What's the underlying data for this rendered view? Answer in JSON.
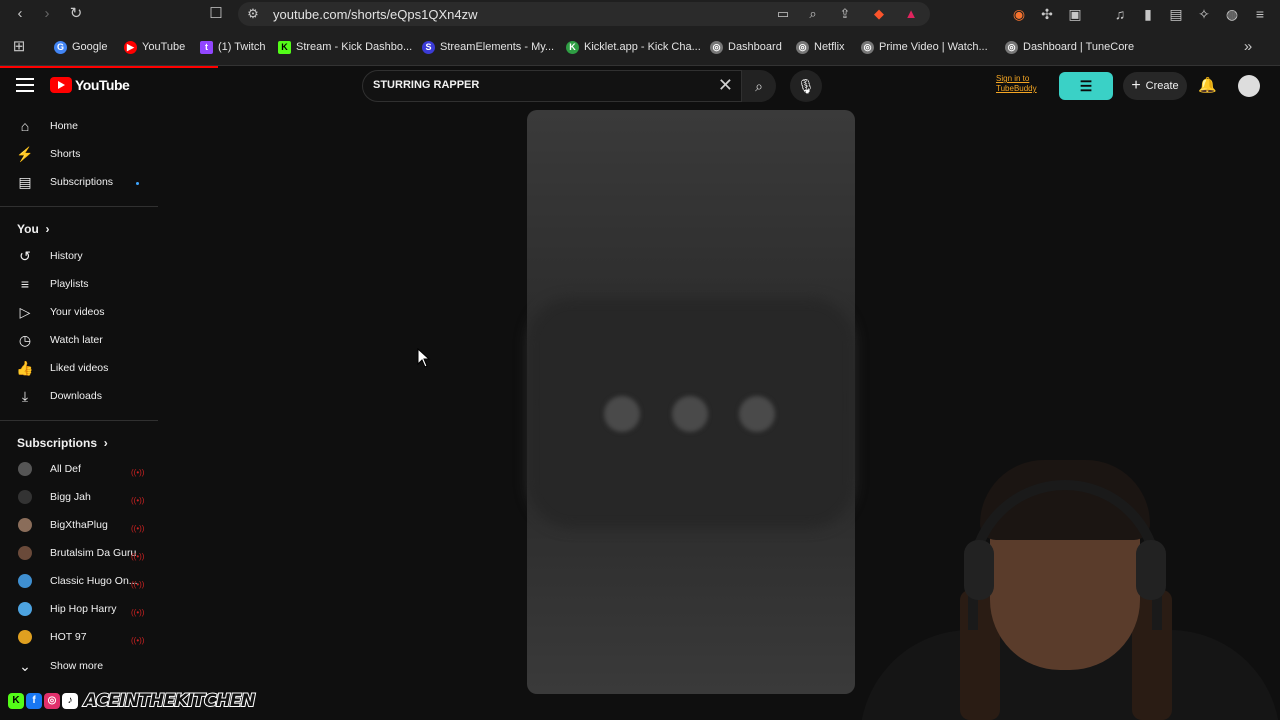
{
  "browser": {
    "url": "youtube.com/shorts/eQps1QXn4zw",
    "bookmarks": [
      {
        "label": "Google",
        "color": "#4285f4",
        "glyph": "G"
      },
      {
        "label": "YouTube",
        "color": "#ff0000",
        "glyph": "▶"
      },
      {
        "label": "(1) Twitch",
        "color": "#9146ff",
        "glyph": "t"
      },
      {
        "label": "Stream - Kick Dashbo...",
        "color": "#53fc18",
        "glyph": "K"
      },
      {
        "label": "StreamElements - My...",
        "color": "#3b3bd6",
        "glyph": "S"
      },
      {
        "label": "Kicklet.app - Kick Cha...",
        "color": "#2f9e44",
        "glyph": "K"
      },
      {
        "label": "Dashboard",
        "color": "#777777",
        "glyph": "◎"
      },
      {
        "label": "Netflix",
        "color": "#777777",
        "glyph": "◎"
      },
      {
        "label": "Prime Video | Watch...",
        "color": "#777777",
        "glyph": "◎"
      },
      {
        "label": "Dashboard | TuneCore",
        "color": "#777777",
        "glyph": "◎"
      }
    ]
  },
  "header": {
    "logo_text": "YouTube",
    "search_query": "STURRING RAPPER",
    "tubebuddy_line1": "Sign in to",
    "tubebuddy_line2": "TubeBuddy",
    "create_label": "Create"
  },
  "sidebar": {
    "main": [
      {
        "label": "Home",
        "icon": "home-icon",
        "glyph": "⌂"
      },
      {
        "label": "Shorts",
        "icon": "shorts-icon",
        "glyph": "⚡"
      },
      {
        "label": "Subscriptions",
        "icon": "subscriptions-icon",
        "glyph": "▤"
      }
    ],
    "you_heading": "You",
    "you_items": [
      {
        "label": "History",
        "icon": "history-icon",
        "glyph": "↺"
      },
      {
        "label": "Playlists",
        "icon": "playlists-icon",
        "glyph": "≡"
      },
      {
        "label": "Your videos",
        "icon": "your-videos-icon",
        "glyph": "▷"
      },
      {
        "label": "Watch later",
        "icon": "watch-later-icon",
        "glyph": "◷"
      },
      {
        "label": "Liked videos",
        "icon": "liked-videos-icon",
        "glyph": "👍"
      },
      {
        "label": "Downloads",
        "icon": "downloads-icon",
        "glyph": "⤓"
      }
    ],
    "subs_heading": "Subscriptions",
    "subscriptions": [
      {
        "label": "All Def",
        "color": "#555555"
      },
      {
        "label": "Bigg Jah",
        "color": "#333333"
      },
      {
        "label": "BigXthaPlug",
        "color": "#8a6d5a"
      },
      {
        "label": "Brutalsim Da Guru",
        "color": "#6a4a3a"
      },
      {
        "label": "Classic Hugo On...",
        "color": "#3f8fd0"
      },
      {
        "label": "Hip Hop Harry",
        "color": "#4da3e0"
      },
      {
        "label": "HOT 97",
        "color": "#e0a020"
      }
    ],
    "show_more": "Show more"
  },
  "overlay": {
    "handle": "ACEINTHEKITCHEN"
  }
}
